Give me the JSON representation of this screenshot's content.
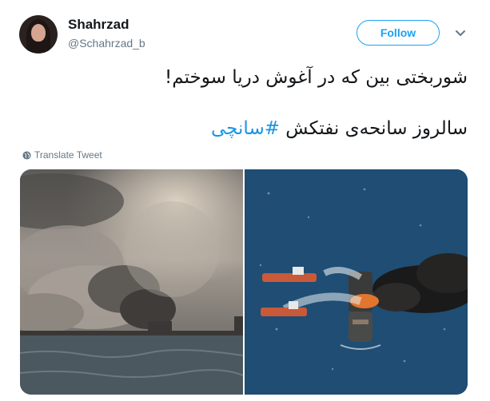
{
  "user": {
    "name": "Shahrzad",
    "handle": "@Schahrzad_b"
  },
  "follow_label": "Follow",
  "tweet": {
    "line1": "شوربختی بین که در آغوش دریا سوختم!",
    "line2_text": "سالروز سانحه‌ی نفتکش ",
    "hashtag": "#سانچی"
  },
  "translate_label": "Translate Tweet",
  "icons": [
    "caret-down-icon",
    "globe-icon"
  ],
  "colors": {
    "accent": "#1da1f2",
    "hashtag": "#1b95e0",
    "text_primary": "#14171a",
    "text_secondary": "#657786"
  }
}
